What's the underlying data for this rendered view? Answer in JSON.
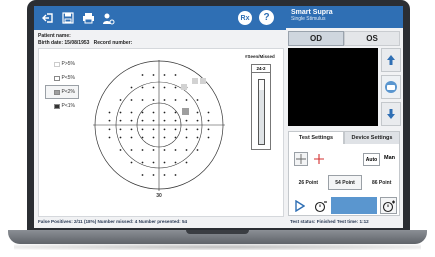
{
  "app": {
    "name": "Smart Supra",
    "subtitle": "Single Stimulus"
  },
  "toolbar": {
    "icons": [
      "logout-icon",
      "save-icon",
      "print-icon",
      "user-settings-icon"
    ],
    "rx_label": "Rx",
    "help_label": "?"
  },
  "patient": {
    "name_label": "Patient name:",
    "birth_label": "Birth date:",
    "birth_value": "15/08/1953",
    "record_label": "Record number:"
  },
  "legend": [
    {
      "label": "P>5%",
      "selected": false
    },
    {
      "label": "P<5%",
      "selected": false
    },
    {
      "label": "P<2%",
      "selected": true
    },
    {
      "label": "P<1%",
      "selected": false
    }
  ],
  "field": {
    "scale_label": "30"
  },
  "seen_missed": {
    "title": "#Seen/Missed",
    "value": "24-2"
  },
  "status_left": {
    "text": "False Positives: 2/11 (18%)   Number missed: 4   Number presented: 54"
  },
  "eyes": {
    "tabs": [
      "OD",
      "OS"
    ],
    "active": "OD"
  },
  "settings": {
    "tabs": [
      "Test Settings",
      "Device Settings"
    ],
    "active": "Test Settings",
    "auto_label": "Auto",
    "man_label": "Man",
    "points": [
      {
        "label": "26 Point",
        "selected": false
      },
      {
        "label": "54 Point",
        "selected": true
      },
      {
        "label": "86 Point",
        "selected": false
      }
    ]
  },
  "status_right": {
    "text": "Test status: Finished   Test time: 1:12"
  },
  "colors": {
    "accent": "#2f6fb4",
    "marked_square": "#9e9e9e",
    "control_box": "#5a96cf"
  }
}
